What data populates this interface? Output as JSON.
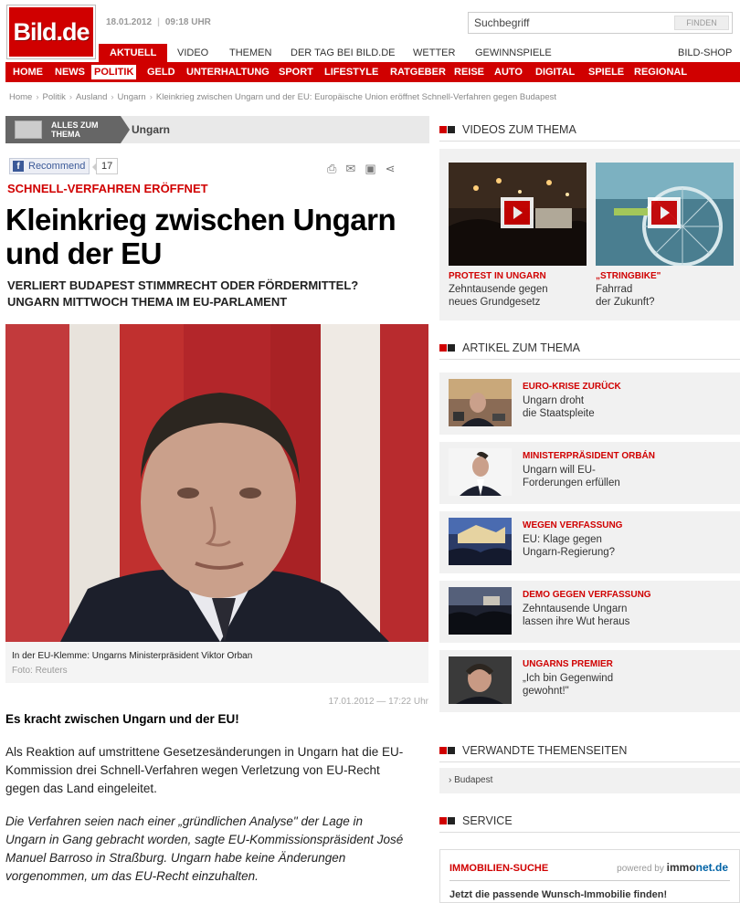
{
  "brand": {
    "logo": "Bild.de"
  },
  "header": {
    "date": "18.01.2012",
    "time": "09:18 UHR",
    "search": {
      "value": "Suchbegriff",
      "button": "FINDEN"
    }
  },
  "nav_primary": [
    "AKTUELL",
    "VIDEO",
    "THEMEN",
    "DER TAG BEI BILD.DE",
    "WETTER",
    "GEWINNSPIELE",
    "BILD-SHOP"
  ],
  "nav_secondary": [
    "HOME",
    "NEWS",
    "POLITIK",
    "GELD",
    "UNTERHALTUNG",
    "SPORT",
    "LIFESTYLE",
    "RATGEBER",
    "REISE",
    "AUTO",
    "DIGITAL",
    "SPIELE",
    "REGIONAL"
  ],
  "breadcrumb": [
    "Home",
    "Politik",
    "Ausland",
    "Ungarn",
    "Kleinkrieg zwischen Ungarn und der EU: Europäische Union eröffnet Schnell-Verfahren gegen Budapest"
  ],
  "theme_bar": {
    "button": "ALLES ZUM THEMA",
    "button_l1": "ALLES ZUM",
    "button_l2": "THEMA",
    "topic": "Ungarn"
  },
  "social": {
    "recommend": "Recommend",
    "count": "17"
  },
  "article": {
    "kicker": "SCHNELL-VERFAHREN ERÖFFNET",
    "headline_l1": "Kleinkrieg zwischen Ungarn",
    "headline_l2": "und der EU",
    "subhead_l1": "VERLIERT BUDAPEST STIMMRECHT ODER FÖRDERMITTEL?",
    "subhead_l2": "UNGARN MITTWOCH THEMA IM EU-PARLAMENT",
    "caption": "In der EU-Klemme: Ungarns Ministerpräsident Viktor Orban",
    "credit": "Foto: Reuters",
    "timestamp": "17.01.2012 — 17:22 Uhr",
    "lead": "Es kracht zwischen Ungarn und der EU!",
    "para1": [
      "Als Reaktion auf umstrittene Gesetzesänderungen in Ungarn hat die EU-",
      "Kommission drei Schnell-Verfahren wegen Verletzung von EU-Recht",
      "gegen das Land eingeleitet."
    ],
    "para2": [
      "Die Verfahren seien nach einer „gründlichen Analyse\" der Lage in",
      "Ungarn in Gang gebracht worden, sagte EU-Kommissionspräsident José",
      "Manuel Barroso in Straßburg. Ungarn habe keine Änderungen",
      "vorgenommen, um das EU-Recht einzuhalten."
    ]
  },
  "sidebar": {
    "videos_title": "VIDEOS ZUM THEMA",
    "videos": [
      {
        "kicker": "PROTEST IN UNGARN",
        "l1": "Zehntausende gegen",
        "l2": "neues Grundgesetz"
      },
      {
        "kicker": "„STRINGBIKE\"",
        "l1": "Fahrrad",
        "l2": "der Zukunft?"
      }
    ],
    "articles_title": "ARTIKEL ZUM THEMA",
    "articles": [
      {
        "kicker": "EURO-KRISE ZURÜCK",
        "l1": "Ungarn droht",
        "l2": "die Staatspleite"
      },
      {
        "kicker": "MINISTERPRÄSIDENT ORBÁN",
        "l1": "Ungarn will EU-",
        "l2": "Forderungen erfüllen"
      },
      {
        "kicker": "WEGEN VERFASSUNG",
        "l1": "EU: Klage gegen",
        "l2": "Ungarn-Regierung?"
      },
      {
        "kicker": "DEMO GEGEN VERFASSUNG",
        "l1": "Zehntausende Ungarn",
        "l2": "lassen ihre Wut heraus"
      },
      {
        "kicker": "UNGARNS PREMIER",
        "l1": "„Ich bin Gegenwind",
        "l2": "gewohnt!\""
      }
    ],
    "related_title": "VERWANDTE THEMENSEITEN",
    "related_link": "Budapest",
    "service_title": "SERVICE",
    "service": {
      "kicker": "IMMOBILIEN-SUCHE",
      "powered": "powered by",
      "brand_a": "immo",
      "brand_b": "net.de",
      "text": "Jetzt die passende Wunsch-Immobilie finden!"
    }
  },
  "colors": {
    "brand_red": "#d00000",
    "sidebar_bg": "#f1f1f1"
  }
}
